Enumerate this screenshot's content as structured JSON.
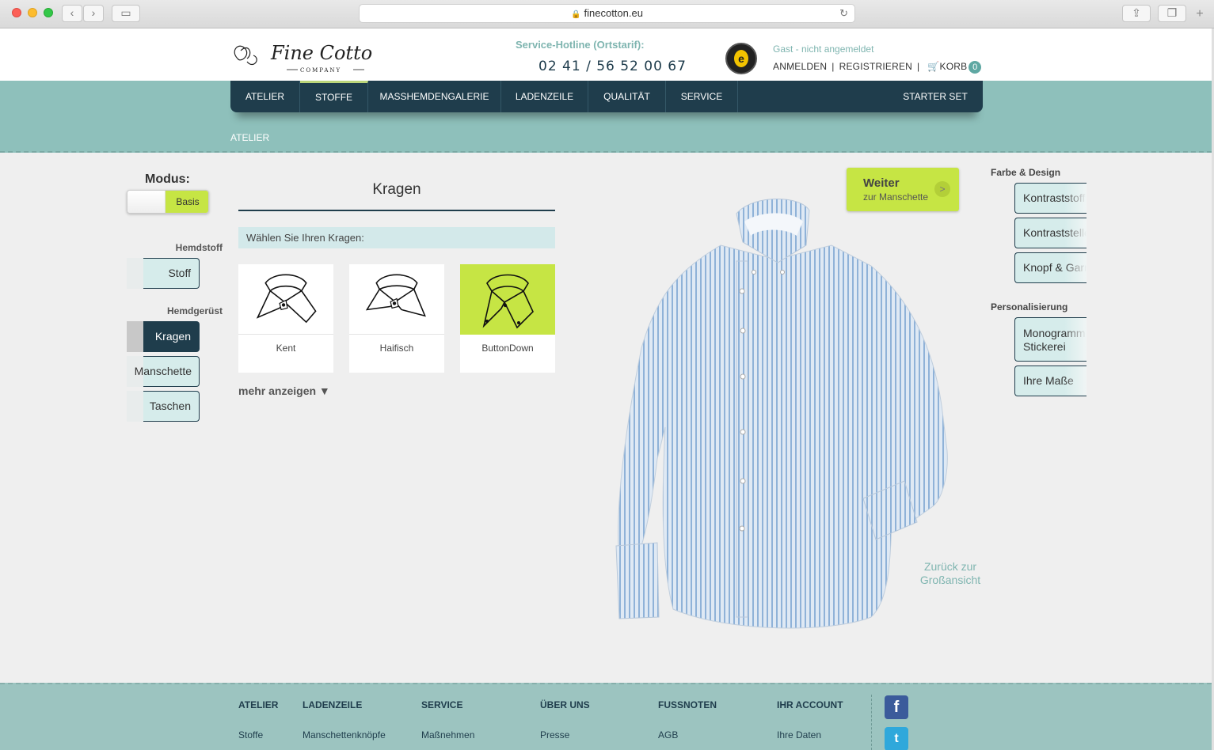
{
  "browser": {
    "url": "finecotton.eu"
  },
  "header": {
    "logo_text": "Fine Cotton",
    "logo_sub": "COMPANY",
    "hotline_title": "Service-Hotline (Ortstarif):",
    "hotline_number": "02 41 / 56 52 00 67",
    "trust_badge_letter": "e",
    "guest_text": "Gast - nicht angemeldet",
    "login": "ANMELDEN",
    "register": "REGISTRIEREN",
    "cart": "KORB",
    "cart_count": "0"
  },
  "nav": {
    "items": [
      "ATELIER",
      "STOFFE",
      "MASSHEMDENGALERIE",
      "LADENZEILE",
      "QUALITÄT",
      "SERVICE"
    ],
    "right": "STARTER SET",
    "active": "STOFFE"
  },
  "breadcrumb": "ATELIER",
  "left": {
    "modus_label": "Modus:",
    "modus_value": "Basis",
    "section1": "Hemdstoff",
    "stoff": "Stoff",
    "section2": "Hemdgerüst",
    "kragen": "Kragen",
    "manschette": "Manschette",
    "taschen": "Taschen"
  },
  "panel": {
    "title": "Kragen",
    "prompt": "Wählen Sie Ihren Kragen:",
    "collars": [
      {
        "label": "Kent"
      },
      {
        "label": "Haifisch"
      },
      {
        "label": "ButtonDown"
      }
    ],
    "selected": "ButtonDown",
    "more": "mehr anzeigen ▼"
  },
  "center": {
    "next_title": "Weiter",
    "next_sub": "zur Manschette",
    "next_arrow": ">",
    "back_line1": "Zurück zur",
    "back_line2": "Großansicht"
  },
  "right": {
    "section1": "Farbe & Design",
    "btn1": "Kontraststoff",
    "btn2": "Kontraststellen",
    "btn3": "Knopf & Garn",
    "section2": "Personalisierung",
    "btn4_l1": "Monogramm",
    "btn4_l2": "Stickerei",
    "btn5": "Ihre Maße"
  },
  "footer": {
    "columns": [
      {
        "title": "ATELIER",
        "link": "Stoffe"
      },
      {
        "title": "LADENZEILE",
        "link": "Manschettenknöpfe"
      },
      {
        "title": "SERVICE",
        "link": "Maßnehmen"
      },
      {
        "title": "ÜBER UNS",
        "link": "Presse"
      },
      {
        "title": "FUSSNOTEN",
        "link": "AGB"
      },
      {
        "title": "IHR ACCOUNT",
        "link": "Ihre Daten"
      }
    ],
    "facebook": "f",
    "twitter": "t"
  },
  "colors": {
    "navy": "#1f3d4c",
    "teal": "#8ec0bb",
    "lime": "#c6e544",
    "light_teal": "#d6eceb"
  }
}
